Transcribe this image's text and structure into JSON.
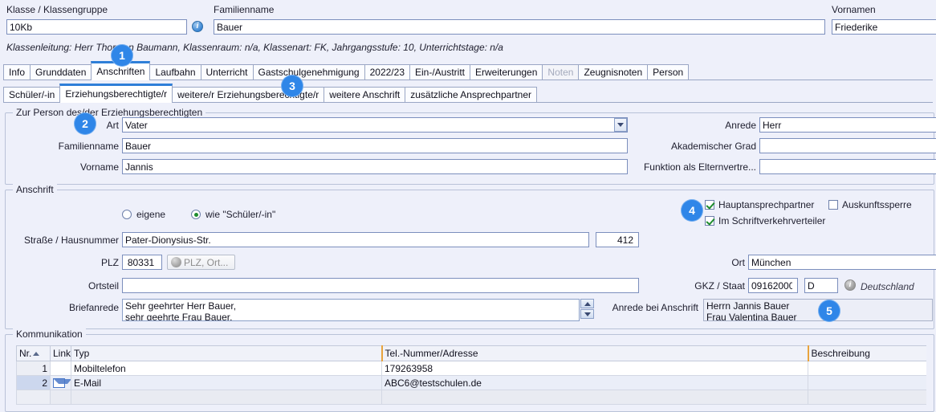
{
  "header": {
    "klasse_label": "Klasse / Klassengruppe",
    "klasse_value": "10Kb",
    "info_icon": "info-icon",
    "familienname_label": "Familienname",
    "familienname_value": "Bauer",
    "vornamen_label": "Vornamen",
    "vornamen_value": "Friederike",
    "class_info": "Klassenleitung: Herr Thorsten Baumann, Klassenraum: n/a, Klassenart: FK, Jahrgangsstufe: 10, Unterrichtstage: n/a"
  },
  "tabs_main": [
    {
      "label": "Info",
      "active": false,
      "disabled": false
    },
    {
      "label": "Grunddaten",
      "active": false,
      "disabled": false
    },
    {
      "label": "Anschriften",
      "active": true,
      "disabled": false
    },
    {
      "label": "Laufbahn",
      "active": false,
      "disabled": false
    },
    {
      "label": "Unterricht",
      "active": false,
      "disabled": false
    },
    {
      "label": "Gastschulgenehmigung",
      "active": false,
      "disabled": false
    },
    {
      "label": "2022/23",
      "active": false,
      "disabled": false
    },
    {
      "label": "Ein-/Austritt",
      "active": false,
      "disabled": false
    },
    {
      "label": "Erweiterungen",
      "active": false,
      "disabled": false
    },
    {
      "label": "Noten",
      "active": false,
      "disabled": true
    },
    {
      "label": "Zeugnisnoten",
      "active": false,
      "disabled": false
    },
    {
      "label": "Person",
      "active": false,
      "disabled": false
    }
  ],
  "tabs_sub": [
    {
      "label": "Schüler/-in",
      "active": false
    },
    {
      "label": "Erziehungsberechtigte/r",
      "active": true
    },
    {
      "label": "weitere/r Erziehungsberechtigte/r",
      "active": false
    },
    {
      "label": "weitere Anschrift",
      "active": false
    },
    {
      "label": "zusätzliche Ansprechpartner",
      "active": false
    }
  ],
  "person_group": {
    "title": "Zur Person des/der Erziehungsberechtigten",
    "art_label": "Art",
    "art_value": "Vater",
    "familienname_label": "Familienname",
    "familienname_value": "Bauer",
    "vorname_label": "Vorname",
    "vorname_value": "Jannis",
    "anrede_label": "Anrede",
    "anrede_value": "Herr",
    "akad_label": "Akademischer Grad",
    "akad_value": "",
    "funktion_label": "Funktion als Elternvertre...",
    "funktion_value": ""
  },
  "anschrift_group": {
    "title": "Anschrift",
    "radio_eigene": "eigene",
    "radio_wie_schueler": "wie \"Schüler/-in\"",
    "radio_selected": "wie_schueler",
    "strasse_label": "Straße / Hausnummer",
    "strasse_value": "Pater-Dionysius-Str.",
    "hausnummer_value": "412",
    "plz_label": "PLZ",
    "plz_value": "80331",
    "plz_button": "PLZ, Ort...",
    "ortsteil_label": "Ortsteil",
    "ortsteil_value": "",
    "briefanrede_label": "Briefanrede",
    "briefanrede_line1": "Sehr geehrter Herr Bauer,",
    "briefanrede_line2": "sehr geehrte Frau Bauer,",
    "ort_label": "Ort",
    "ort_value": "München",
    "gkz_label": "GKZ / Staat",
    "gkz_value": "09162000",
    "staat_value": "D",
    "staat_name": "Deutschland",
    "staat_info_icon": "info-icon-grey",
    "anrede_anschrift_label": "Anrede bei Anschrift",
    "anrede_anschrift_line1": "Herrn Jannis Bauer",
    "anrede_anschrift_line2": "Frau Valentina Bauer",
    "checkbox_haupt": "Hauptansprechpartner",
    "checkbox_haupt_checked": true,
    "checkbox_schrift": "Im Schriftverkehrverteiler",
    "checkbox_schrift_checked": true,
    "checkbox_auskunft": "Auskunftssperre",
    "checkbox_auskunft_checked": false
  },
  "kommunikation": {
    "title": "Kommunikation",
    "columns": [
      "Nr.",
      "Link",
      "Typ",
      "Tel.-Nummer/Adresse",
      "Beschreibung"
    ],
    "rows": [
      {
        "nr": "1",
        "link": "",
        "typ": "Mobiltelefon",
        "adresse": "179263958",
        "beschreibung": ""
      },
      {
        "nr": "2",
        "link": "mail-icon",
        "typ": "E-Mail",
        "adresse": "ABC6@testschulen.de",
        "beschreibung": ""
      },
      {
        "nr": "",
        "link": "",
        "typ": "",
        "adresse": "",
        "beschreibung": ""
      }
    ]
  },
  "badges": [
    {
      "n": "1"
    },
    {
      "n": "2"
    },
    {
      "n": "3"
    },
    {
      "n": "4"
    },
    {
      "n": "5"
    }
  ],
  "colors": {
    "background": "#eef0fa",
    "accent": "#2f86e8",
    "active_tab_border": "#2f7fd8",
    "check_green": "#1e8c2e"
  }
}
